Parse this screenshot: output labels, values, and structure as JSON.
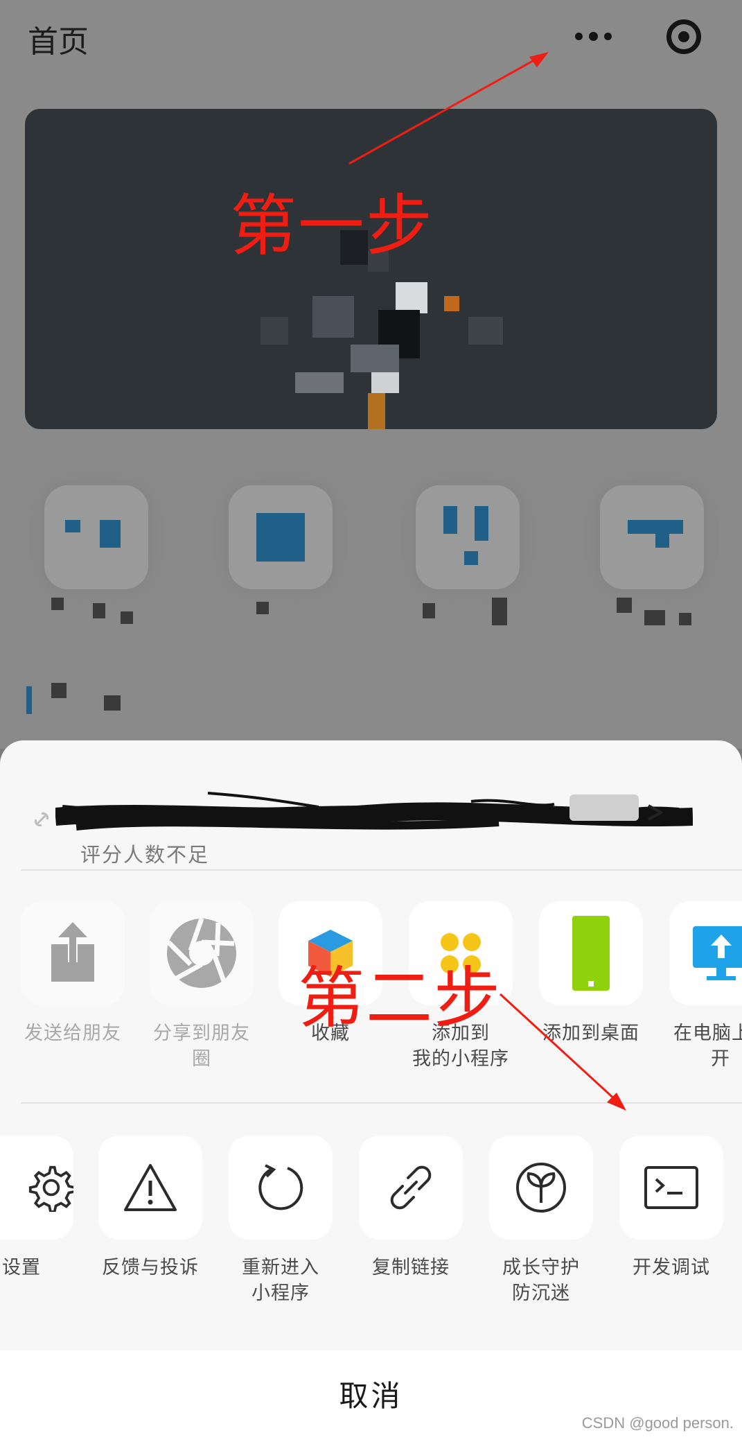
{
  "page": {
    "title": "首页"
  },
  "annotations": {
    "step1": "第一步",
    "step2": "第二步"
  },
  "app_info": {
    "rating": "评分人数不足"
  },
  "share_row": [
    {
      "label": "发送给朋友",
      "icon": "upload-share-icon",
      "faded": true
    },
    {
      "label": "分享到朋友圈",
      "icon": "moments-aperture-icon",
      "faded": true
    },
    {
      "label": "收藏",
      "icon": "favorites-cube-icon",
      "faded": false
    },
    {
      "label": "添加到我的小程序",
      "icon": "my-miniprogram-icon",
      "faded": false
    },
    {
      "label": "添加到桌面",
      "icon": "add-to-desktop-icon",
      "faded": false
    },
    {
      "label": "在电脑上打开",
      "icon": "open-on-pc-icon",
      "faded": false
    }
  ],
  "labels": {
    "send": "发送给朋友",
    "moments_1": "分享到朋友",
    "moments_2": "圈",
    "favorite": "收藏",
    "add_mine_1": "添加到",
    "add_mine_2": "我的小程序",
    "add_desktop": "添加到桌面",
    "pc_1": "在电脑上",
    "pc_2": "开",
    "settings": "设置",
    "feedback": "反馈与投诉",
    "reenter_1": "重新进入",
    "reenter_2": "小程序",
    "copy_link": "复制链接",
    "guard_1": "成长守护",
    "guard_2": "防沉迷",
    "devtools": "开发调试"
  },
  "cancel": "取消",
  "watermark": "CSDN @good person.",
  "colors": {
    "annotation_red": "#f01e12",
    "sheet_bg": "#f7f7f7",
    "desktop_green": "#8fd10b",
    "pc_blue": "#1fa3e8"
  }
}
